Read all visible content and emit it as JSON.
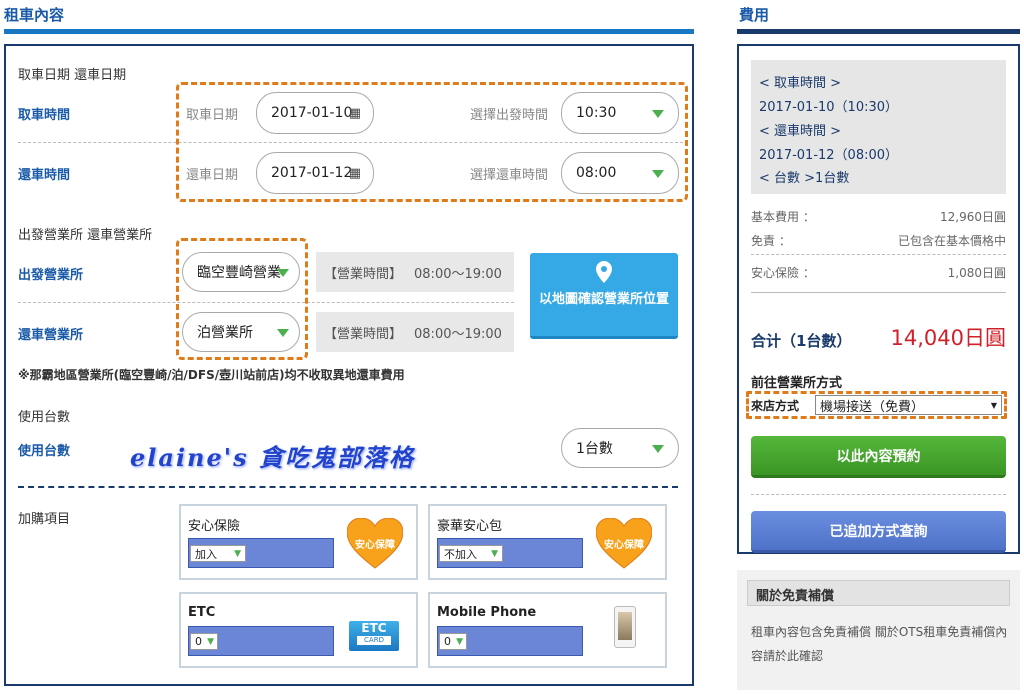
{
  "left": {
    "title": "租車內容",
    "date_section_label": "取車日期 還車日期",
    "pickup_time_label": "取車時間",
    "return_time_label": "還車時間",
    "pickup_date_label": "取車日期",
    "pickup_date_value": "2017-01-10",
    "depart_time_label": "選擇出發時間",
    "depart_time_value": "10:30",
    "return_date_label": "還車日期",
    "return_date_value": "2017-01-12",
    "return_select_label": "選擇還車時間",
    "return_time_value": "08:00",
    "office_section_label": "出發營業所 還車營業所",
    "depart_office_label": "出發營業所",
    "depart_office_value": "臨空豐崎營業所",
    "return_office_label": "還車營業所",
    "return_office_value": "泊營業所",
    "hours_label": "【營業時間】",
    "depart_hours": "08:00～19:00",
    "return_hours": "08:00～19:00",
    "map_button": "以地圖確認營業所位置",
    "note": "※那霸地區營業所(臨空豐崎/泊/DFS/壺川站前店)均不收取異地還車費用",
    "units_section_label": "使用台數",
    "units_label": "使用台數",
    "units_value": "1台數",
    "watermark": "elaine's 貪吃鬼部落格",
    "addons_label": "加購項目",
    "addons": [
      {
        "name": "安心保險",
        "value": "加入",
        "badge": "安心保障"
      },
      {
        "name": "豪華安心包",
        "value": "不加入",
        "badge": "安心保障"
      },
      {
        "name": "ETC",
        "value": "0",
        "badge": "ETC",
        "badge_sub": "CARD"
      },
      {
        "name": "Mobile Phone",
        "value": "0"
      }
    ]
  },
  "right": {
    "title": "費用",
    "pickup_time_heading": "< 取車時間 >",
    "pickup_time": "2017-01-10（10:30）",
    "return_time_heading": "< 還車時間 >",
    "return_time": "2017-01-12（08:00）",
    "units_line": "< 台數 >1台數",
    "fees": [
      {
        "label": "基本費用 ：",
        "value": "12,960日圓"
      },
      {
        "label": "免責 ：",
        "value": "已包含在基本價格中"
      },
      {
        "label": "安心保險 ：",
        "value": "1,080日圓"
      }
    ],
    "total_label": "合计（1台數）",
    "total_value": "14,040日圓",
    "method_label": "前往營業所方式",
    "method_field_label": "來店方式",
    "method_value": "機場接送（免費）",
    "book_button": "以此內容預約",
    "query_button": "已追加方式查詢",
    "disclaimer_title": "關於免責補償",
    "disclaimer_text": "租車內容包含免責補償 關於OTS租車免責補償內容請於此確認"
  },
  "colors": {
    "accent": "#1a78c2",
    "navy": "#1a3a6b",
    "orange": "#e07b1a",
    "green": "#4caf50",
    "red": "#d0202a"
  }
}
